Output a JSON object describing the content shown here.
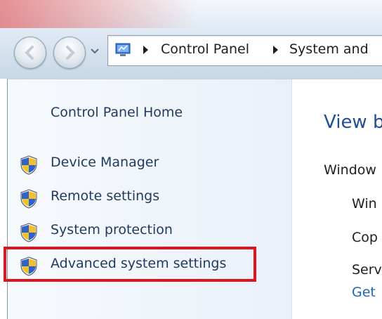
{
  "window": {
    "breadcrumbs": [
      "Control Panel",
      "System and"
    ],
    "icons": {
      "back": "back-arrow-icon",
      "forward": "forward-arrow-icon",
      "history": "chevron-down-icon",
      "location": "control-panel-icon"
    }
  },
  "sidebar": {
    "home": "Control Panel Home",
    "tasks": [
      {
        "label": "Device Manager",
        "icon": "uac-shield-icon"
      },
      {
        "label": "Remote settings",
        "icon": "uac-shield-icon"
      },
      {
        "label": "System protection",
        "icon": "uac-shield-icon"
      },
      {
        "label": "Advanced system settings",
        "icon": "uac-shield-icon",
        "highlighted": true
      }
    ]
  },
  "main": {
    "title": "View b",
    "section": "Window",
    "lines": [
      "Win",
      "Cop",
      "Serv"
    ],
    "link": "Get"
  },
  "colors": {
    "highlight": "#e0141c",
    "link": "#1c66b8",
    "title": "#1f4e94"
  }
}
